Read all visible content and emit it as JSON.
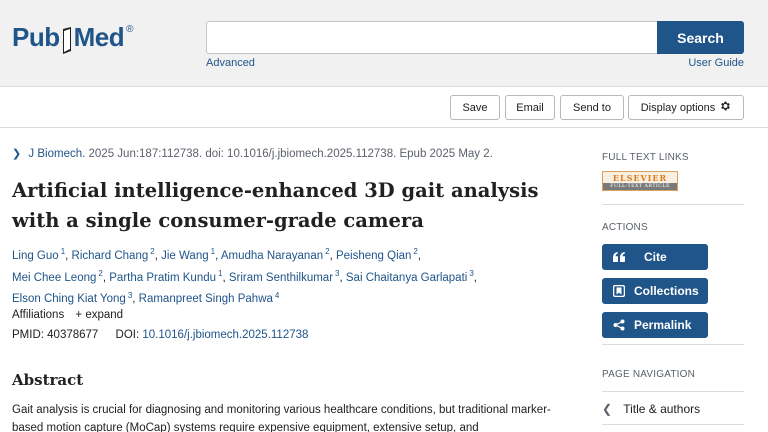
{
  "header": {
    "logo_pub": "Pub",
    "logo_med": "Med",
    "logo_reg": "®",
    "search_placeholder": "",
    "search_label": "Search",
    "advanced": "Advanced",
    "user_guide": "User Guide",
    "brand_color": "#20558a"
  },
  "toolbar": {
    "save": "Save",
    "email": "Email",
    "send_to": "Send to",
    "display_options": "Display options"
  },
  "article": {
    "journal": "J Biomech.",
    "citation": "2025 Jun:187:112738. doi: 10.1016/j.jbiomech.2025.112738. Epub 2025 May 2.",
    "title": "Artificial intelligence-enhanced 3D gait analysis with a single consumer-grade camera",
    "authors": [
      {
        "name": "Ling Guo",
        "aff": "1"
      },
      {
        "name": "Richard Chang",
        "aff": "2"
      },
      {
        "name": "Jie Wang",
        "aff": "1"
      },
      {
        "name": "Amudha Narayanan",
        "aff": "2"
      },
      {
        "name": "Peisheng Qian",
        "aff": "2"
      },
      {
        "name": "Mei Chee Leong",
        "aff": "2"
      },
      {
        "name": "Partha Pratim Kundu",
        "aff": "1"
      },
      {
        "name": "Sriram Senthilkumar",
        "aff": "3"
      },
      {
        "name": "Sai Chaitanya Garlapati",
        "aff": "3"
      },
      {
        "name": "Elson Ching Kiat Yong",
        "aff": "3"
      },
      {
        "name": "Ramanpreet Singh Pahwa",
        "aff": "4"
      }
    ],
    "affiliations_label": "Affiliations",
    "expand_label": "+ expand",
    "pmid_label": "PMID:",
    "pmid": "40378677",
    "doi_label": "DOI:",
    "doi": "10.1016/j.jbiomech.2025.112738",
    "abstract_heading": "Abstract",
    "abstract_text": "Gait analysis is crucial for diagnosing and monitoring various healthcare conditions, but traditional marker-based motion capture (MoCap) systems require expensive equipment, extensive setup, and"
  },
  "sidebar": {
    "full_text_links": "FULL TEXT LINKS",
    "elsevier_top": "ELSEVIER",
    "elsevier_bottom": "FULL-TEXT ARTICLE",
    "actions": "ACTIONS",
    "cite": "Cite",
    "collections": "Collections",
    "permalink": "Permalink",
    "page_navigation": "PAGE NAVIGATION",
    "nav_title_authors": "Title & authors"
  }
}
